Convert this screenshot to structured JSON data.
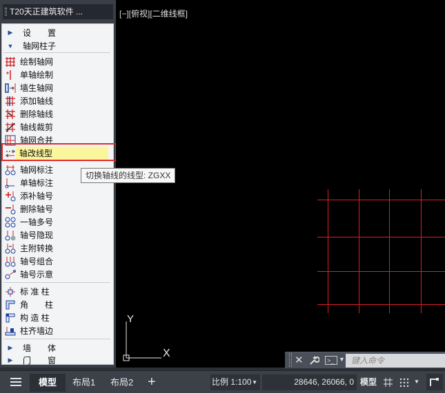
{
  "palette": {
    "title": "T20天正建筑软件 ...",
    "categories": {
      "settings": "设　　置",
      "axis": "轴网柱子",
      "wall": "墙　　体",
      "door": "门　　窗"
    },
    "items": [
      {
        "label": "绘制轴网",
        "icon": "grid-draw-icon"
      },
      {
        "label": "单轴绘制",
        "icon": "single-axis-icon"
      },
      {
        "label": "墙生轴网",
        "icon": "wall-axis-icon"
      },
      {
        "label": "添加轴线",
        "icon": "add-axis-icon"
      },
      {
        "label": "删除轴线",
        "icon": "delete-axis-icon"
      },
      {
        "label": "轴线裁剪",
        "icon": "trim-axis-icon"
      },
      {
        "label": "轴网合并",
        "icon": "merge-grid-icon"
      },
      {
        "label": "轴改线型",
        "icon": "change-linetype-icon"
      },
      {
        "label": "轴网标注",
        "icon": "grid-dimension-icon"
      },
      {
        "label": "单轴标注",
        "icon": "single-dimension-icon"
      },
      {
        "label": "添补轴号",
        "icon": "add-number-icon"
      },
      {
        "label": "删除轴号",
        "icon": "delete-number-icon"
      },
      {
        "label": "一轴多号",
        "icon": "multi-number-icon"
      },
      {
        "label": "轴号隐现",
        "icon": "hide-number-icon"
      },
      {
        "label": "主附转换",
        "icon": "convert-number-icon"
      },
      {
        "label": "轴号组合",
        "icon": "combine-number-icon"
      },
      {
        "label": "轴号示意",
        "icon": "sketch-number-icon"
      },
      {
        "label": "标 准 柱",
        "icon": "standard-column-icon"
      },
      {
        "label": "角　　柱",
        "icon": "corner-column-icon"
      },
      {
        "label": "构 造 柱",
        "icon": "structural-column-icon"
      },
      {
        "label": "柱齐墙边",
        "icon": "align-column-icon"
      }
    ]
  },
  "tooltip": "切换轴线的线型: ZGXX",
  "viewport": {
    "label": "[−][俯视][二维线框]"
  },
  "ucs": {
    "x": "X",
    "y": "Y"
  },
  "command": {
    "placeholder": "键入命令"
  },
  "statusbar": {
    "tabs": [
      "模型",
      "布局1",
      "布局2"
    ],
    "add": "+",
    "scale": "比例 1:100",
    "coords": "28646, 26066, 0",
    "space": "模型"
  },
  "colors": {
    "grid": "#e0201e",
    "highlight": "#e02a2a",
    "selected": "#fbf59c"
  }
}
